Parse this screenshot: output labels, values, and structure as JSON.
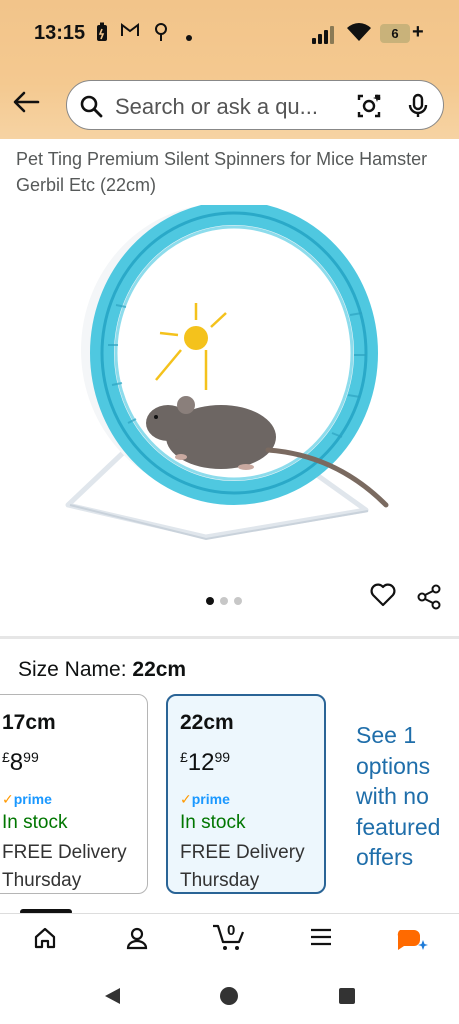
{
  "status_bar": {
    "time": "13:15",
    "battery": "6",
    "battery_plus": "+"
  },
  "search": {
    "placeholder": "Search or ask a qu..."
  },
  "product": {
    "title": "Pet Ting Premium Silent Spinners for Mice Hamster Gerbil Etc (22cm)",
    "image_count": 3,
    "active_image": 1
  },
  "size": {
    "label": "Size Name:",
    "value": "22cm",
    "options": [
      {
        "name": "17cm",
        "currency": "£",
        "whole": "8",
        "fraction": "99",
        "prime": "prime",
        "stock": "In stock",
        "delivery": "FREE Delivery",
        "day": "Thursday",
        "selected": false
      },
      {
        "name": "22cm",
        "currency": "£",
        "whole": "12",
        "fraction": "99",
        "prime": "prime",
        "stock": "In stock",
        "delivery": "FREE Delivery",
        "day": "Thursday",
        "selected": true
      }
    ],
    "see_more": "See 1 options with no featured offers"
  },
  "bottom_nav": {
    "items": [
      "home-icon",
      "account-icon",
      "cart-icon",
      "menu-icon",
      "rufus-icon"
    ],
    "cart_count": "0"
  },
  "colors": {
    "header_bg": "#f3c68d",
    "selected_border": "#2a6496",
    "selected_bg": "#edf7fd",
    "link": "#1f6eaa",
    "in_stock": "#007600",
    "prime_blue": "#1a98ff",
    "prime_check": "#ff9900"
  }
}
